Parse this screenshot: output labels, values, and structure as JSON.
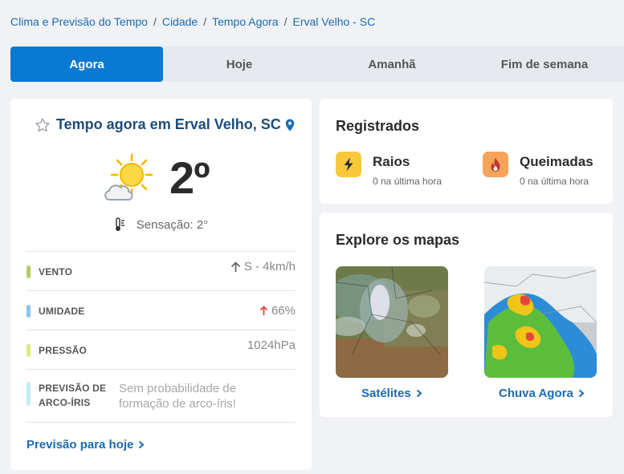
{
  "breadcrumb": {
    "items": [
      "Clima e Previsão do Tempo",
      "Cidade",
      "Tempo Agora",
      "Erval Velho - SC"
    ],
    "separator": "/"
  },
  "tabs": [
    {
      "label": "Agora",
      "active": true
    },
    {
      "label": "Hoje",
      "active": false
    },
    {
      "label": "Amanhã",
      "active": false
    },
    {
      "label": "Fim de semana",
      "active": false
    }
  ],
  "now": {
    "title": "Tempo agora em Erval Velho, SC",
    "temperature": "2º",
    "weather_icon": "sun-cloud-icon",
    "sensation": "Sensação: 2°",
    "details": [
      {
        "label": "VENTO",
        "value": "S - 4km/h",
        "color": "#b5cc63",
        "icon": "arrow-up-icon"
      },
      {
        "label": "UMIDADE",
        "value": "66%",
        "color": "#8cc3ec",
        "icon": "arrow-up-red-icon"
      },
      {
        "label": "PRESSÃO",
        "value": "1024hPa",
        "color": "#dcea7e"
      },
      {
        "label_line1": "PREVISÃO DE",
        "label_line2": "ARCO-ÍRIS",
        "value_line1": "Sem probabilidade de",
        "value_line2": "formação de arco-íris!",
        "color": "#c3ecf5"
      }
    ],
    "link": "Previsão para hoje"
  },
  "registered": {
    "title": "Registrados",
    "items": [
      {
        "name": "Raios",
        "sub": "0 na última hora",
        "icon": "lightning-icon",
        "color": "#f7c93a"
      },
      {
        "name": "Queimadas",
        "sub": "0 na última hora",
        "icon": "fire-icon",
        "color": "#f7a35a"
      }
    ]
  },
  "maps": {
    "title": "Explore os mapas",
    "items": [
      {
        "label": "Satélites",
        "image": "satellite-map"
      },
      {
        "label": "Chuva Agora",
        "image": "rain-radar-map"
      }
    ]
  },
  "colors": {
    "accent": "#0a79d2",
    "link": "#1b6bb0",
    "title": "#1d4d7a"
  }
}
